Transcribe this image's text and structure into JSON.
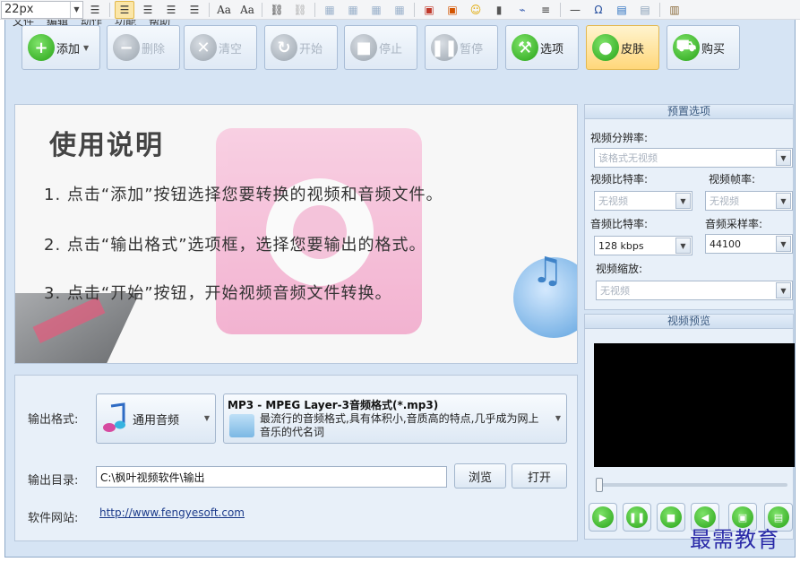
{
  "editor_toolbar": {
    "font_size": "22px",
    "icons": [
      "indent-icon",
      "align-left-icon",
      "align-center-icon",
      "align-right-icon",
      "justify-icon",
      "font-grow-icon",
      "font-shrink-icon",
      "link-icon",
      "unlink-icon",
      "table-icon",
      "table-icon",
      "table-icon",
      "table-icon",
      "image-icon",
      "media-icon",
      "emoji-icon",
      "video-icon",
      "attach-icon",
      "list-icon",
      "hr-icon",
      "omega-icon",
      "code-icon",
      "preview-icon",
      "paste-icon"
    ],
    "omega_glyph": "Ω",
    "active_color": "#fbe6a8"
  },
  "menubar": [
    "文件",
    "编辑",
    "动作",
    "功能",
    "帮助"
  ],
  "toolbar": {
    "add": "添加",
    "delete": "删除",
    "clear": "清空",
    "start": "开始",
    "stop": "停止",
    "pause": "暂停",
    "options": "选项",
    "skin": "皮肤",
    "buy": "购买"
  },
  "instructions": {
    "title": "使用说明",
    "lines": [
      "1. 点击“添加”按钮选择您要转换的视频和音频文件。",
      "2. 点击“输出格式”选项框，选择您要输出的格式。",
      "3. 点击“开始”按钮，开始视频音频文件转换。"
    ]
  },
  "output": {
    "format_label": "输出格式:",
    "format_category": "通用音频",
    "format_title": "MP3 - MPEG Layer-3音频格式(*.mp3)",
    "format_desc": "最流行的音频格式,具有体积小,音质高的特点,几乎成为网上音乐的代名词",
    "dir_label": "输出目录:",
    "dir_value": "C:\\枫叶视频软件\\输出",
    "browse": "浏览",
    "open": "打开",
    "site_label": "软件网站:",
    "site_url": "http://www.fengyesoft.com"
  },
  "presets": {
    "header": "预置选项",
    "resolution_label": "视频分辨率:",
    "resolution_value": "该格式无视频",
    "vbitrate_label": "视频比特率:",
    "vbitrate_value": "无视频",
    "framerate_label": "视频帧率:",
    "framerate_value": "无视频",
    "abitrate_label": "音频比特率:",
    "abitrate_value": "128 kbps",
    "samplerate_label": "音频采样率:",
    "samplerate_value": "44100",
    "scale_label": "视频缩放:",
    "scale_value": "无视频"
  },
  "preview": {
    "header": "视频预览",
    "slider_position": 0
  },
  "watermark": "最需教育"
}
